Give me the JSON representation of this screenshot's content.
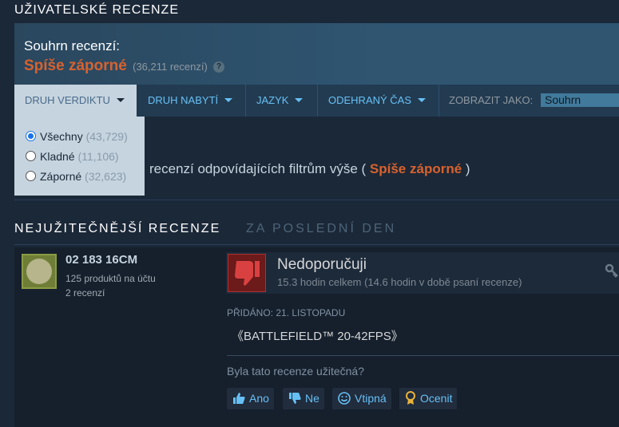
{
  "header": {
    "title": "UŽIVATELSKÉ RECENZE"
  },
  "summary": {
    "label": "Souhrn recenzí:",
    "verdict": "Spíše záporné",
    "count": "(36,211 recenzí)",
    "help_icon": "question-icon"
  },
  "filters": [
    {
      "label": "DRUH VERDIKTU",
      "active": true
    },
    {
      "label": "DRUH NABYTÍ",
      "active": false
    },
    {
      "label": "JAZYK",
      "active": false
    },
    {
      "label": "ODEHRANÝ ČAS",
      "active": false
    }
  ],
  "display": {
    "label": "ZOBRAZIT JAKO:",
    "value": "Souhrn"
  },
  "dropdown": {
    "options": [
      {
        "label": "Všechny",
        "count": "(43,729)",
        "checked": true
      },
      {
        "label": "Kladné",
        "count": "(11,106)",
        "checked": false
      },
      {
        "label": "Záporné",
        "count": "(32,623)",
        "checked": false
      }
    ]
  },
  "match": {
    "text": "recenzí odpovídajících filtrům výše (",
    "verdict": "Spíše záporné",
    "close": ")"
  },
  "helpful": {
    "title": "NEJUŽITEČNĚJŠÍ RECENZE",
    "period": "ZA POSLEDNÍ DEN"
  },
  "review": {
    "user": {
      "name": "02 183 16CM",
      "products": "125 produktů na účtu",
      "reviews": "2 recenzí"
    },
    "verdict": "Nedoporučuji",
    "hours": "15.3 hodin celkem (14.6 hodin v době psaní recenze)",
    "posted": "PŘIDÁNO: 21. LISTOPADU",
    "text": "《BATTLEFIELD™ 20-42FPS》",
    "question": "Byla tato recenze užitečná?",
    "buttons": {
      "yes": "Ano",
      "no": "Ne",
      "funny": "Vtipná",
      "award": "Ocenit"
    }
  },
  "colors": {
    "background": "#1b2838",
    "accent": "#66c0f4",
    "negative": "#d8622e"
  }
}
